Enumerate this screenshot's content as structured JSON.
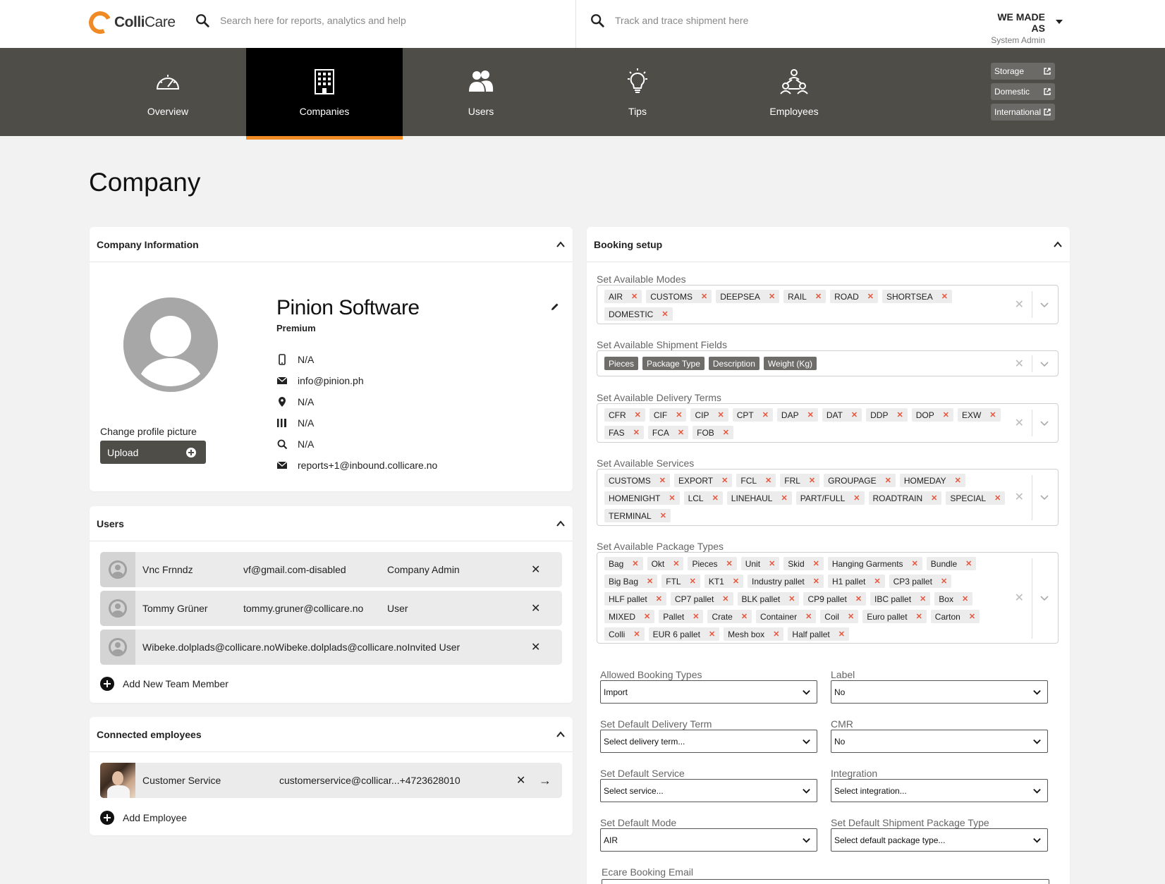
{
  "brand": {
    "name_bold": "Colli",
    "name_rest": "Care",
    "accent": "#f08a24",
    "nav_bg": "#4e4d48"
  },
  "search": {
    "reports_placeholder": "Search here for reports, analytics and help",
    "track_placeholder": "Track and trace shipment here"
  },
  "account": {
    "name": "WE MADE AS",
    "role": "System Admin"
  },
  "nav": {
    "items": [
      {
        "label": "Overview",
        "icon": "gauge-icon"
      },
      {
        "label": "Companies",
        "icon": "building-icon"
      },
      {
        "label": "Users",
        "icon": "users-icon"
      },
      {
        "label": "Tips",
        "icon": "lightbulb-icon"
      },
      {
        "label": "Employees",
        "icon": "network-people-icon"
      }
    ],
    "active": "Companies",
    "external": [
      "Storage",
      "Domestic",
      "International"
    ]
  },
  "page": {
    "title": "Company"
  },
  "company_info": {
    "title": "Company Information",
    "name": "Pinion Software",
    "tier": "Premium",
    "change_picture": "Change profile picture",
    "upload": "Upload",
    "phone": "N/A",
    "email": "info@pinion.ph",
    "address": "N/A",
    "barcode": "N/A",
    "search_code": "N/A",
    "reports_email": "reports+1@inbound.collicare.no"
  },
  "users": {
    "title": "Users",
    "rows": [
      {
        "name": "Vnc Frnndz",
        "email": "vf@gmail.com-disabled",
        "role": "Company Admin"
      },
      {
        "name": "Tommy Grüner",
        "email": "tommy.gruner@collicare.no",
        "role": "User"
      },
      {
        "name": "Wibeke.dolplads@collicare.noWibeke.dolplads@collicare.noInvited User",
        "email": "",
        "role": ""
      }
    ],
    "add": "Add New Team Member"
  },
  "employees": {
    "title": "Connected employees",
    "rows": [
      {
        "name": "Customer Service",
        "contact": "customerservice@collicar...+4723628010"
      }
    ],
    "add": "Add Employee"
  },
  "booking": {
    "title": "Booking setup",
    "modes_label": "Set Available Modes",
    "modes": [
      "AIR",
      "CUSTOMS",
      "DEEPSEA",
      "RAIL",
      "ROAD",
      "SHORTSEA",
      "DOMESTIC"
    ],
    "fields_label": "Set Available Shipment Fields",
    "fields": [
      "Pieces",
      "Package Type",
      "Description",
      "Weight (Kg)"
    ],
    "terms_label": "Set Available Delivery Terms",
    "terms": [
      "CFR",
      "CIF",
      "CIP",
      "CPT",
      "DAP",
      "DAT",
      "DDP",
      "DOP",
      "EXW",
      "FAS",
      "FCA",
      "FOB"
    ],
    "services_label": "Set Available Services",
    "services": [
      "CUSTOMS",
      "EXPORT",
      "FCL",
      "FRL",
      "GROUPAGE",
      "HOMEDAY",
      "HOMENIGHT",
      "LCL",
      "LINEHAUL",
      "PART/FULL",
      "ROADTRAIN",
      "SPECIAL",
      "TERMINAL"
    ],
    "packages_label": "Set Available Package Types",
    "packages": [
      "Bag",
      "Okt",
      "Pieces",
      "Unit",
      "Skid",
      "Hanging Garments",
      "Bundle",
      "Big Bag",
      "FTL",
      "KT1",
      "Industry pallet",
      "H1 pallet",
      "CP3 pallet",
      "HLF pallet",
      "CP7 pallet",
      "BLK pallet",
      "CP9 pallet",
      "IBC pallet",
      "Box",
      "MIXED",
      "Pallet",
      "Crate",
      "Container",
      "Coil",
      "Euro pallet",
      "Carton",
      "Colli",
      "EUR 6 pallet",
      "Mesh box",
      "Half pallet"
    ],
    "selects": {
      "booking_types": {
        "label": "Allowed Booking Types",
        "value": "Import"
      },
      "label": {
        "label": "Label",
        "value": "No"
      },
      "delivery_term": {
        "label": "Set Default Delivery Term",
        "value": "Select delivery term..."
      },
      "cmr": {
        "label": "CMR",
        "value": "No"
      },
      "service": {
        "label": "Set Default Service",
        "value": "Select service..."
      },
      "integration": {
        "label": "Integration",
        "value": "Select integration..."
      },
      "mode": {
        "label": "Set Default Mode",
        "value": "AIR"
      },
      "package_type": {
        "label": "Set Default Shipment Package Type",
        "value": "Select default package type..."
      }
    },
    "ecare_label": "Ecare Booking Email"
  }
}
